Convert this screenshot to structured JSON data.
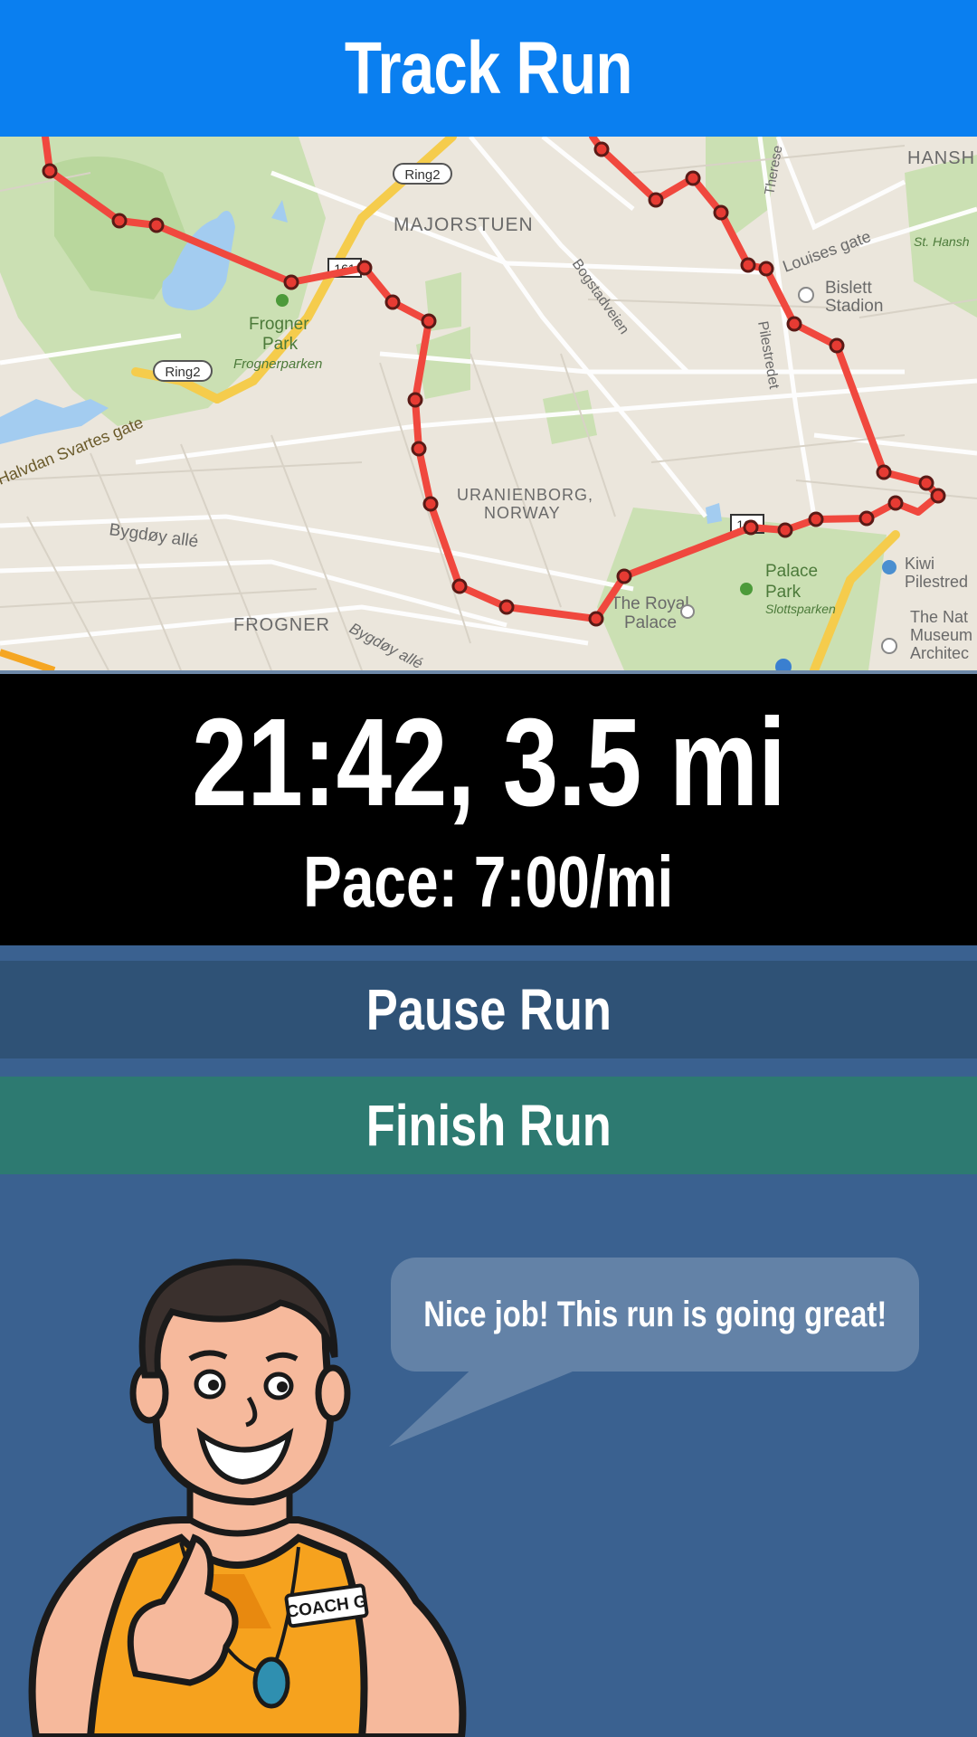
{
  "header": {
    "title": "Track Run"
  },
  "map": {
    "labels": {
      "majorstuen": "MAJORSTUEN",
      "frogner_park": "Frogner",
      "frogner_park2": "Park",
      "frognerparken": "Frognerparken",
      "uranienborg": "URANIENBORG,",
      "norway": "NORWAY",
      "frogner": "FROGNER",
      "bygdoy1": "Bygdøy allé",
      "bygdoy2": "Bygdøy allé",
      "halvdan": "Halvdan Svartes gate",
      "bogstadveien": "Bogstadveien",
      "pilestredet": "Pilestredet",
      "louises": "Louises gate",
      "bislett": "Bislett",
      "stadion": "Stadion",
      "palace": "Palace",
      "park": "Park",
      "slottsparken": "Slottsparken",
      "royal": "The Royal",
      "palace2": "Palace",
      "kiwi": "Kiwi",
      "kiwi2": "Pilestred",
      "natmus": "The Nat",
      "natmus2": "Museum",
      "natmus3": "Architec",
      "hansh": "HANSH",
      "sthansh": "St. Hansh",
      "therese": "Therese",
      "ring2a": "Ring2",
      "ring2b": "Ring2",
      "r161a": "161",
      "r161b": "161"
    }
  },
  "stats": {
    "time_distance": "21:42, 3.5 mi",
    "pace": "Pace: 7:00/mi"
  },
  "buttons": {
    "pause": "Pause Run",
    "finish": "Finish Run"
  },
  "coach": {
    "message": "Nice job! This run is going great!",
    "badge": "COACH G"
  },
  "colors": {
    "header": "#0a7ff0",
    "route": "#f0483e",
    "pause": "#2f5276",
    "finish": "#2d7a71",
    "background": "#3a6190"
  }
}
